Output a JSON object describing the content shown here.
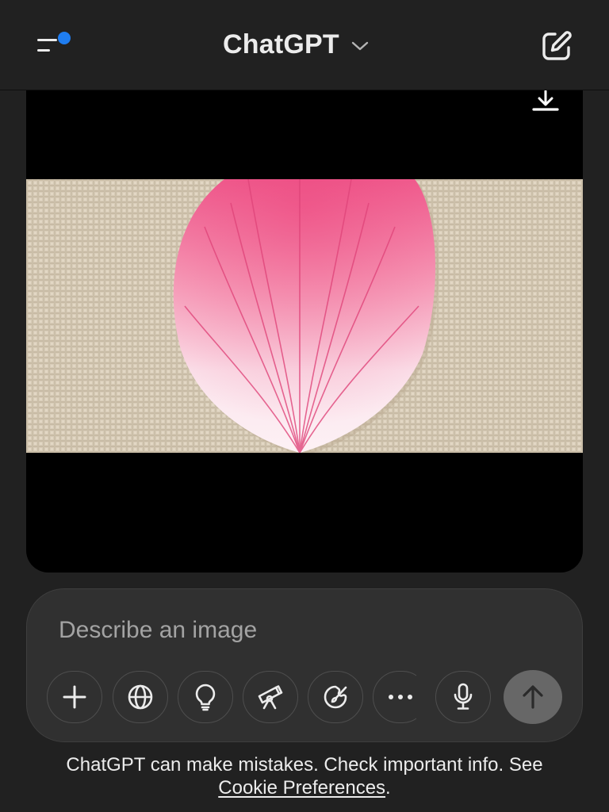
{
  "app": {
    "title": "ChatGPT"
  },
  "header": {
    "menu_icon": "sidebar-menu-icon",
    "notification_dot_color": "#1f7df0",
    "model_selector_icon": "chevron-down-icon",
    "compose_icon": "new-chat-pencil-icon"
  },
  "image_card": {
    "download_icon": "download-icon",
    "image_subject": "pink-petal-embroidery-on-linen"
  },
  "composer": {
    "placeholder": "Describe an image",
    "tools": [
      {
        "name": "add",
        "icon": "plus-icon"
      },
      {
        "name": "search",
        "icon": "globe-icon"
      },
      {
        "name": "reason",
        "icon": "lightbulb-icon"
      },
      {
        "name": "deep-research",
        "icon": "telescope-icon"
      },
      {
        "name": "create-image",
        "icon": "paintbrush-icon"
      },
      {
        "name": "more",
        "icon": "ellipsis-icon"
      }
    ],
    "mic_icon": "microphone-icon",
    "send_icon": "arrow-up-icon",
    "send_button_color": "#676767"
  },
  "footer": {
    "text": "ChatGPT can make mistakes. Check important info. See",
    "link_text": "Cookie Preferences",
    "suffix": "."
  }
}
